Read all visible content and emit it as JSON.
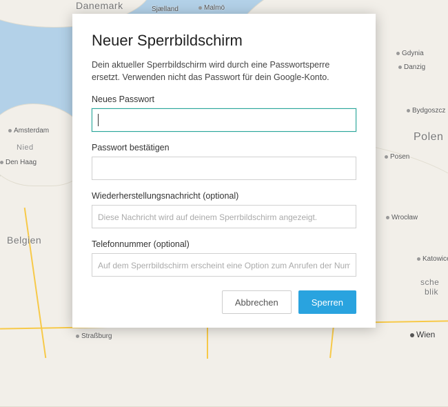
{
  "modal": {
    "title": "Neuer Sperrbildschirm",
    "description": "Dein aktueller Sperrbildschirm wird durch eine Passwortsperre ersetzt. Verwenden nicht das Passwort für dein Google-Konto.",
    "fields": {
      "password": {
        "label": "Neues Passwort",
        "value": "",
        "placeholder": ""
      },
      "confirm": {
        "label": "Passwort bestätigen",
        "value": "",
        "placeholder": ""
      },
      "recovery": {
        "label": "Wiederherstellungsnachricht (optional)",
        "value": "",
        "placeholder": "Diese Nachricht wird auf deinem Sperrbildschirm angezeigt."
      },
      "phone": {
        "label": "Telefonnummer (optional)",
        "value": "",
        "placeholder": "Auf dem Sperrbildschirm erscheint eine Option zum Anrufen der Nummer."
      }
    },
    "buttons": {
      "cancel": "Abbrechen",
      "lock": "Sperren"
    }
  },
  "map": {
    "countries": {
      "denmark": "Danemark",
      "belgium": "Belgien",
      "poland": "Polen",
      "czech_prefix": "sche",
      "czech_suffix": "blik",
      "ned": "Nied"
    },
    "cities": {
      "sjaelland": "Sjælland",
      "malmo": "Malmö",
      "gdynia": "Gdynia",
      "danzig": "Danzig",
      "bydgoszcz": "Bydgoszcz",
      "posen": "Posen",
      "wroclaw": "Wrocław",
      "katowice": "Katowice",
      "wien": "Wien",
      "strasbourg": "Straßburg",
      "amsterdam": "Amsterdam",
      "denhaag": "Den Haag"
    }
  }
}
